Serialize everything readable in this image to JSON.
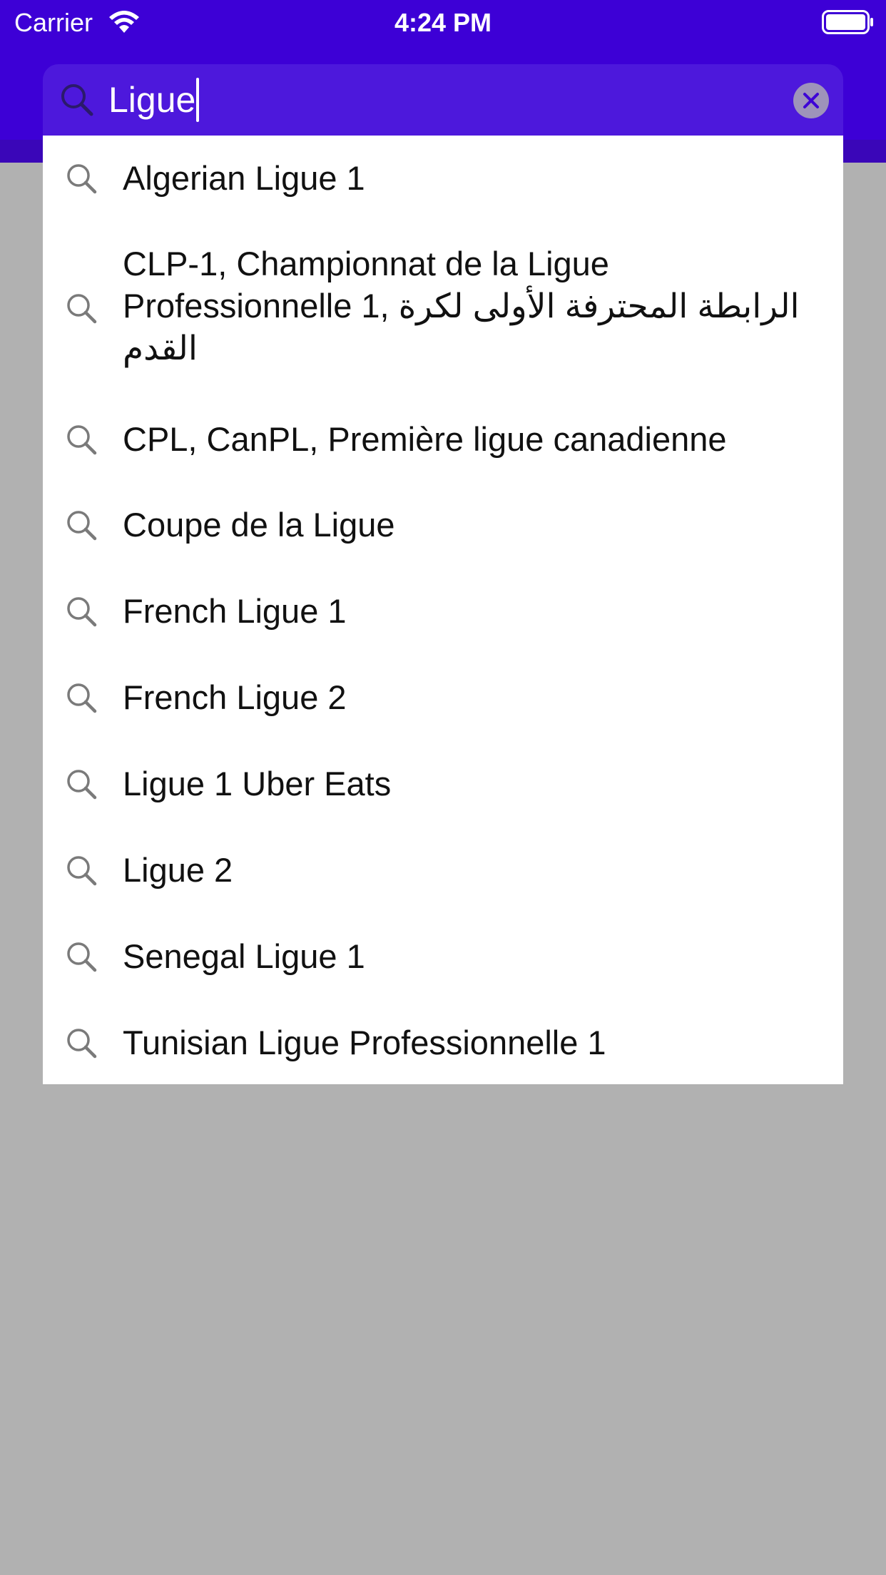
{
  "status_bar": {
    "carrier": "Carrier",
    "time": "4:24 PM",
    "icons": [
      "wifi-icon",
      "battery-icon"
    ]
  },
  "search": {
    "query": "Ligue",
    "icon": "search-icon",
    "clear_icon": "clear-icon"
  },
  "suggestions": [
    {
      "label": "Algerian Ligue 1",
      "icon": "search-icon"
    },
    {
      "label": "CLP-1, Championnat de la Ligue Professionnelle 1, الرابطة المحترفة الأولى لكرة القدم",
      "icon": "search-icon"
    },
    {
      "label": "CPL, CanPL, Première ligue canadienne",
      "icon": "search-icon"
    },
    {
      "label": "Coupe de la Ligue",
      "icon": "search-icon"
    },
    {
      "label": "French Ligue 1",
      "icon": "search-icon"
    },
    {
      "label": "French Ligue 2",
      "icon": "search-icon"
    },
    {
      "label": "Ligue 1 Uber Eats",
      "icon": "search-icon"
    },
    {
      "label": "Ligue 2",
      "icon": "search-icon"
    },
    {
      "label": "Senegal Ligue 1",
      "icon": "search-icon"
    },
    {
      "label": "Tunisian Ligue Professionnelle 1",
      "icon": "search-icon"
    }
  ],
  "colors": {
    "brand": "#3d00d6",
    "search_field": "#4d18dc",
    "dimmed_background": "#b1b1b1",
    "dropdown_background": "#ffffff"
  }
}
